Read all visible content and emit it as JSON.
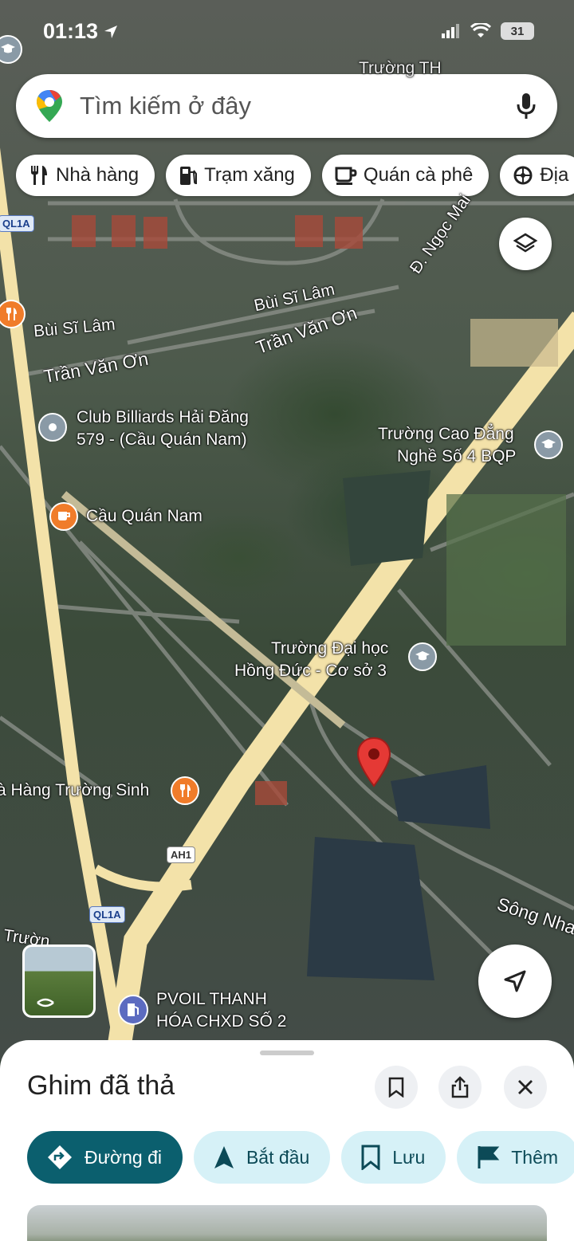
{
  "status_bar": {
    "time": "01:13",
    "battery": "31"
  },
  "search": {
    "placeholder": "Tìm kiếm ở đây"
  },
  "chips": [
    {
      "label": "Nhà hàng",
      "icon": "fork-knife-icon"
    },
    {
      "label": "Trạm xăng",
      "icon": "gas-station-icon"
    },
    {
      "label": "Quán cà phê",
      "icon": "coffee-cup-icon"
    },
    {
      "label": "Địa",
      "icon": "landmark-icon"
    }
  ],
  "map": {
    "street_labels": {
      "bui_si_lam_1": "Bùi Sĩ Lâm",
      "bui_si_lam_2": "Bùi Sĩ Lâm",
      "tran_van_on_1": "Trần Văn Ơn",
      "tran_van_on_2": "Trần Văn Ơn",
      "ngoc_mai": "Đ. Ngọc Mai",
      "song_nha": "Sông Nha"
    },
    "shields": {
      "ql1a_top": "QL1A",
      "ah1": "AH1",
      "ql1a_bottom": "QL1A"
    },
    "places": {
      "truong_th": "Trường TH",
      "billiards_line1": "Club Billiards Hải Đăng",
      "billiards_line2": "579 - (Cầu Quán Nam)",
      "cau_quan_nam": "Cầu Quán Nam",
      "cao_dang_line1": "Trường Cao Đẳng",
      "cao_dang_line2": "Nghề Số 4 BQP",
      "dai_hoc_line1": "Trường Đại học",
      "dai_hoc_line2": "Hồng Đức - Cơ sở 3",
      "truong_sinh": "à Hàng Trường Sinh",
      "truong_partial": "Trườn",
      "pvoil_line1": "PVOIL THANH",
      "pvoil_line2": "HÓA CHXD SỐ 2"
    },
    "colors": {
      "road": "#f3e2a9",
      "pin": "#e53935",
      "restaurant_poi": "#f07c2a",
      "gas_poi": "#5c6bc0",
      "school_poi": "#8a9aa6"
    }
  },
  "sheet": {
    "title": "Ghim đã thả",
    "actions": [
      {
        "label": "Đường đi",
        "icon": "directions-icon",
        "style": "primary"
      },
      {
        "label": "Bắt đầu",
        "icon": "navigation-arrow-icon",
        "style": "secondary"
      },
      {
        "label": "Lưu",
        "icon": "bookmark-icon",
        "style": "secondary"
      },
      {
        "label": "Thêm",
        "icon": "flag-icon",
        "style": "secondary"
      }
    ]
  }
}
